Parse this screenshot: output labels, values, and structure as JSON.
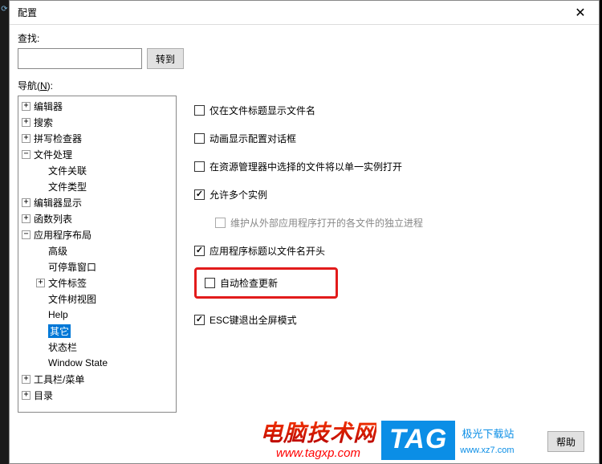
{
  "title": "配置",
  "search": {
    "label": "查找:",
    "button": "转到",
    "value": ""
  },
  "nav_label_prefix": "导航(",
  "nav_label_hotkey": "N",
  "nav_label_suffix": "):",
  "tree": [
    {
      "label": "编辑器",
      "expandable": true,
      "expanded": false,
      "depth": 0
    },
    {
      "label": "搜索",
      "expandable": true,
      "expanded": false,
      "depth": 0
    },
    {
      "label": "拼写检查器",
      "expandable": true,
      "expanded": false,
      "depth": 0
    },
    {
      "label": "文件处理",
      "expandable": true,
      "expanded": true,
      "depth": 0
    },
    {
      "label": "文件关联",
      "expandable": false,
      "depth": 1
    },
    {
      "label": "文件类型",
      "expandable": false,
      "depth": 1
    },
    {
      "label": "编辑器显示",
      "expandable": true,
      "expanded": false,
      "depth": 0
    },
    {
      "label": "函数列表",
      "expandable": true,
      "expanded": false,
      "depth": 0
    },
    {
      "label": "应用程序布局",
      "expandable": true,
      "expanded": true,
      "depth": 0
    },
    {
      "label": "高级",
      "expandable": false,
      "depth": 1
    },
    {
      "label": "可停靠窗口",
      "expandable": false,
      "depth": 1
    },
    {
      "label": "文件标签",
      "expandable": true,
      "expanded": false,
      "depth": 1
    },
    {
      "label": "文件树视图",
      "expandable": false,
      "depth": 1
    },
    {
      "label": "Help",
      "expandable": false,
      "depth": 1
    },
    {
      "label": "其它",
      "expandable": false,
      "depth": 1,
      "selected": true
    },
    {
      "label": "状态栏",
      "expandable": false,
      "depth": 1
    },
    {
      "label": "Window State",
      "expandable": false,
      "depth": 1
    },
    {
      "label": "工具栏/菜单",
      "expandable": true,
      "expanded": false,
      "depth": 0
    },
    {
      "label": "目录",
      "expandable": true,
      "expanded": false,
      "depth": 0
    }
  ],
  "options": [
    {
      "label": "仅在文件标题显示文件名",
      "checked": false,
      "type": "normal"
    },
    {
      "label": "动画显示配置对话框",
      "checked": false,
      "type": "normal"
    },
    {
      "label": "在资源管理器中选择的文件将以单一实例打开",
      "checked": false,
      "type": "normal"
    },
    {
      "label": "允许多个实例",
      "checked": true,
      "type": "normal"
    },
    {
      "label": "维护从外部应用程序打开的各文件的独立进程",
      "checked": false,
      "type": "indent-disabled"
    },
    {
      "label": "应用程序标题以文件名开头",
      "checked": true,
      "type": "normal"
    },
    {
      "label": "自动检查更新",
      "checked": false,
      "type": "highlighted"
    },
    {
      "label": "ESC键退出全屏模式",
      "checked": true,
      "type": "normal"
    }
  ],
  "help_button": "帮助",
  "watermark": {
    "cn": "电脑技术网",
    "url": "www.tagxp.com",
    "tag": "TAG",
    "site": "极光下载站",
    "site_url": "www.xz7.com"
  }
}
